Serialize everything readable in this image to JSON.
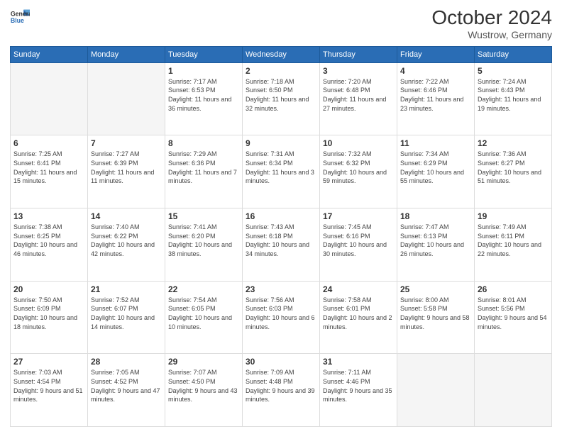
{
  "header": {
    "logo_line1": "General",
    "logo_line2": "Blue",
    "month_year": "October 2024",
    "location": "Wustrow, Germany"
  },
  "weekdays": [
    "Sunday",
    "Monday",
    "Tuesday",
    "Wednesday",
    "Thursday",
    "Friday",
    "Saturday"
  ],
  "weeks": [
    [
      {
        "day": "",
        "empty": true
      },
      {
        "day": "",
        "empty": true
      },
      {
        "day": "1",
        "sunrise": "Sunrise: 7:17 AM",
        "sunset": "Sunset: 6:53 PM",
        "daylight": "Daylight: 11 hours and 36 minutes."
      },
      {
        "day": "2",
        "sunrise": "Sunrise: 7:18 AM",
        "sunset": "Sunset: 6:50 PM",
        "daylight": "Daylight: 11 hours and 32 minutes."
      },
      {
        "day": "3",
        "sunrise": "Sunrise: 7:20 AM",
        "sunset": "Sunset: 6:48 PM",
        "daylight": "Daylight: 11 hours and 27 minutes."
      },
      {
        "day": "4",
        "sunrise": "Sunrise: 7:22 AM",
        "sunset": "Sunset: 6:46 PM",
        "daylight": "Daylight: 11 hours and 23 minutes."
      },
      {
        "day": "5",
        "sunrise": "Sunrise: 7:24 AM",
        "sunset": "Sunset: 6:43 PM",
        "daylight": "Daylight: 11 hours and 19 minutes."
      }
    ],
    [
      {
        "day": "6",
        "sunrise": "Sunrise: 7:25 AM",
        "sunset": "Sunset: 6:41 PM",
        "daylight": "Daylight: 11 hours and 15 minutes."
      },
      {
        "day": "7",
        "sunrise": "Sunrise: 7:27 AM",
        "sunset": "Sunset: 6:39 PM",
        "daylight": "Daylight: 11 hours and 11 minutes."
      },
      {
        "day": "8",
        "sunrise": "Sunrise: 7:29 AM",
        "sunset": "Sunset: 6:36 PM",
        "daylight": "Daylight: 11 hours and 7 minutes."
      },
      {
        "day": "9",
        "sunrise": "Sunrise: 7:31 AM",
        "sunset": "Sunset: 6:34 PM",
        "daylight": "Daylight: 11 hours and 3 minutes."
      },
      {
        "day": "10",
        "sunrise": "Sunrise: 7:32 AM",
        "sunset": "Sunset: 6:32 PM",
        "daylight": "Daylight: 10 hours and 59 minutes."
      },
      {
        "day": "11",
        "sunrise": "Sunrise: 7:34 AM",
        "sunset": "Sunset: 6:29 PM",
        "daylight": "Daylight: 10 hours and 55 minutes."
      },
      {
        "day": "12",
        "sunrise": "Sunrise: 7:36 AM",
        "sunset": "Sunset: 6:27 PM",
        "daylight": "Daylight: 10 hours and 51 minutes."
      }
    ],
    [
      {
        "day": "13",
        "sunrise": "Sunrise: 7:38 AM",
        "sunset": "Sunset: 6:25 PM",
        "daylight": "Daylight: 10 hours and 46 minutes."
      },
      {
        "day": "14",
        "sunrise": "Sunrise: 7:40 AM",
        "sunset": "Sunset: 6:22 PM",
        "daylight": "Daylight: 10 hours and 42 minutes."
      },
      {
        "day": "15",
        "sunrise": "Sunrise: 7:41 AM",
        "sunset": "Sunset: 6:20 PM",
        "daylight": "Daylight: 10 hours and 38 minutes."
      },
      {
        "day": "16",
        "sunrise": "Sunrise: 7:43 AM",
        "sunset": "Sunset: 6:18 PM",
        "daylight": "Daylight: 10 hours and 34 minutes."
      },
      {
        "day": "17",
        "sunrise": "Sunrise: 7:45 AM",
        "sunset": "Sunset: 6:16 PM",
        "daylight": "Daylight: 10 hours and 30 minutes."
      },
      {
        "day": "18",
        "sunrise": "Sunrise: 7:47 AM",
        "sunset": "Sunset: 6:13 PM",
        "daylight": "Daylight: 10 hours and 26 minutes."
      },
      {
        "day": "19",
        "sunrise": "Sunrise: 7:49 AM",
        "sunset": "Sunset: 6:11 PM",
        "daylight": "Daylight: 10 hours and 22 minutes."
      }
    ],
    [
      {
        "day": "20",
        "sunrise": "Sunrise: 7:50 AM",
        "sunset": "Sunset: 6:09 PM",
        "daylight": "Daylight: 10 hours and 18 minutes."
      },
      {
        "day": "21",
        "sunrise": "Sunrise: 7:52 AM",
        "sunset": "Sunset: 6:07 PM",
        "daylight": "Daylight: 10 hours and 14 minutes."
      },
      {
        "day": "22",
        "sunrise": "Sunrise: 7:54 AM",
        "sunset": "Sunset: 6:05 PM",
        "daylight": "Daylight: 10 hours and 10 minutes."
      },
      {
        "day": "23",
        "sunrise": "Sunrise: 7:56 AM",
        "sunset": "Sunset: 6:03 PM",
        "daylight": "Daylight: 10 hours and 6 minutes."
      },
      {
        "day": "24",
        "sunrise": "Sunrise: 7:58 AM",
        "sunset": "Sunset: 6:01 PM",
        "daylight": "Daylight: 10 hours and 2 minutes."
      },
      {
        "day": "25",
        "sunrise": "Sunrise: 8:00 AM",
        "sunset": "Sunset: 5:58 PM",
        "daylight": "Daylight: 9 hours and 58 minutes."
      },
      {
        "day": "26",
        "sunrise": "Sunrise: 8:01 AM",
        "sunset": "Sunset: 5:56 PM",
        "daylight": "Daylight: 9 hours and 54 minutes."
      }
    ],
    [
      {
        "day": "27",
        "sunrise": "Sunrise: 7:03 AM",
        "sunset": "Sunset: 4:54 PM",
        "daylight": "Daylight: 9 hours and 51 minutes."
      },
      {
        "day": "28",
        "sunrise": "Sunrise: 7:05 AM",
        "sunset": "Sunset: 4:52 PM",
        "daylight": "Daylight: 9 hours and 47 minutes."
      },
      {
        "day": "29",
        "sunrise": "Sunrise: 7:07 AM",
        "sunset": "Sunset: 4:50 PM",
        "daylight": "Daylight: 9 hours and 43 minutes."
      },
      {
        "day": "30",
        "sunrise": "Sunrise: 7:09 AM",
        "sunset": "Sunset: 4:48 PM",
        "daylight": "Daylight: 9 hours and 39 minutes."
      },
      {
        "day": "31",
        "sunrise": "Sunrise: 7:11 AM",
        "sunset": "Sunset: 4:46 PM",
        "daylight": "Daylight: 9 hours and 35 minutes."
      },
      {
        "day": "",
        "empty": true
      },
      {
        "day": "",
        "empty": true
      }
    ]
  ]
}
